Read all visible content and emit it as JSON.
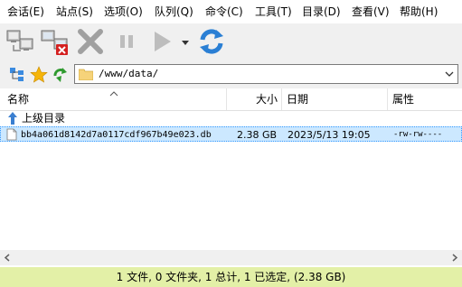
{
  "menu": [
    "会话(E)",
    "站点(S)",
    "选项(O)",
    "队列(Q)",
    "命令(C)",
    "工具(T)",
    "目录(D)",
    "查看(V)",
    "帮助(H)"
  ],
  "address": {
    "path": "/www/data/"
  },
  "columns": {
    "name": "名称",
    "size": "大小",
    "date": "日期",
    "attr": "属性"
  },
  "parent_dir": "上级目录",
  "files": [
    {
      "name": "bb4a061d8142d7a0117cdf967b49e023.db",
      "size": "2.38 GB",
      "date": "2023/5/13 19:05",
      "attr": "-rw-rw----"
    }
  ],
  "status": "1 文件, 0 文件夹, 1 总计, 1 已选定, (2.38 GB)",
  "colors": {
    "toolbar_bg": "#f0f0f0",
    "selected_row": "#cce8ff",
    "status_bg": "#e3f0a7",
    "menu_bg": "#ffffff"
  }
}
